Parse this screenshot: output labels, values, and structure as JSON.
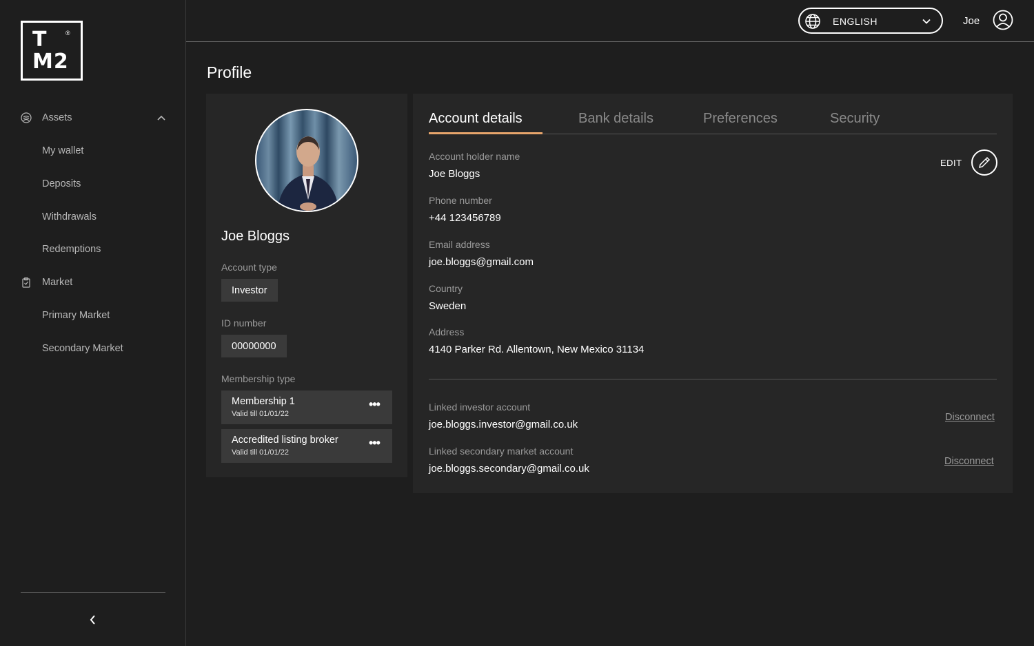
{
  "logo": {
    "line1": "T",
    "line2": "M2",
    "reg": "®"
  },
  "sidebar": {
    "items": [
      {
        "label": "Assets",
        "icon": "coins-icon",
        "expanded": true
      },
      {
        "label": "My wallet"
      },
      {
        "label": "Deposits"
      },
      {
        "label": "Withdrawals"
      },
      {
        "label": "Redemptions"
      },
      {
        "label": "Market",
        "icon": "clipboard-icon"
      },
      {
        "label": "Primary Market"
      },
      {
        "label": "Secondary Market"
      }
    ],
    "collapse_icon": "chevron-left-icon"
  },
  "header": {
    "language": "ENGLISH",
    "language_icon": "globe-icon",
    "user_name": "Joe",
    "user_icon": "user-circle-icon"
  },
  "page": {
    "title": "Profile"
  },
  "profile": {
    "name": "Joe Bloggs",
    "account_type_label": "Account type",
    "account_type": "Investor",
    "id_label": "ID number",
    "id_number": "00000000",
    "membership_label": "Membership type",
    "memberships": [
      {
        "title": "Membership 1",
        "valid": "Valid till 01/01/22",
        "more": "•••"
      },
      {
        "title": "Accredited listing broker",
        "valid": "Valid till 01/01/22",
        "more": "•••"
      }
    ]
  },
  "tabs": [
    {
      "label": "Account details",
      "active": true
    },
    {
      "label": "Bank details",
      "active": false
    },
    {
      "label": "Preferences",
      "active": false
    },
    {
      "label": "Security",
      "active": false
    }
  ],
  "account": {
    "edit_label": "EDIT",
    "edit_icon": "pencil-icon",
    "fields": [
      {
        "label": "Account holder name",
        "value": "Joe Bloggs"
      },
      {
        "label": "Phone number",
        "value": "+44 123456789"
      },
      {
        "label": "Email address",
        "value": "joe.bloggs@gmail.com"
      },
      {
        "label": "Country",
        "value": "Sweden"
      },
      {
        "label": "Address",
        "value": "4140 Parker Rd. Allentown, New Mexico 31134"
      }
    ],
    "linked": [
      {
        "label": "Linked investor account",
        "value": "joe.bloggs.investor@gmail.co.uk",
        "action": "Disconnect"
      },
      {
        "label": "Linked secondary market account",
        "value": "joe.bloggs.secondary@gmail.co.uk",
        "action": "Disconnect"
      }
    ]
  },
  "colors": {
    "background": "#1e1e1e",
    "card": "#262626",
    "chip": "#3a3a3a",
    "accent": "#e8a56b"
  }
}
